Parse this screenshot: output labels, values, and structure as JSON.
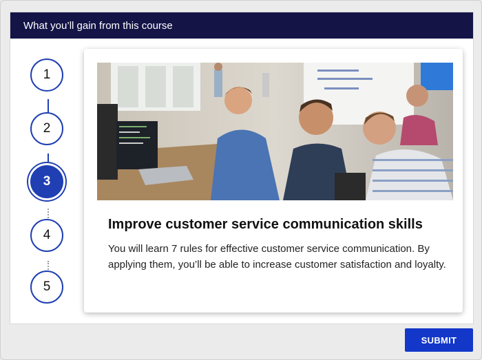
{
  "header": {
    "title": "What you’ll gain from this course"
  },
  "steps": [
    {
      "label": "1",
      "state": "completed"
    },
    {
      "label": "2",
      "state": "completed"
    },
    {
      "label": "3",
      "state": "active"
    },
    {
      "label": "4",
      "state": "upcoming"
    },
    {
      "label": "5",
      "state": "upcoming"
    }
  ],
  "card": {
    "image": "office-team-discussion-photo",
    "title": "Improve customer service communication skills",
    "text": "You will learn 7 rules for effective customer service communication. By applying them, you’ll be able to increase customer satisfaction and loyalty."
  },
  "footer": {
    "submit_label": "SUBMIT"
  },
  "colors": {
    "header_bg": "#141447",
    "accent": "#1f3fb3",
    "button": "#1237c9",
    "page_bg": "#ebebeb"
  }
}
